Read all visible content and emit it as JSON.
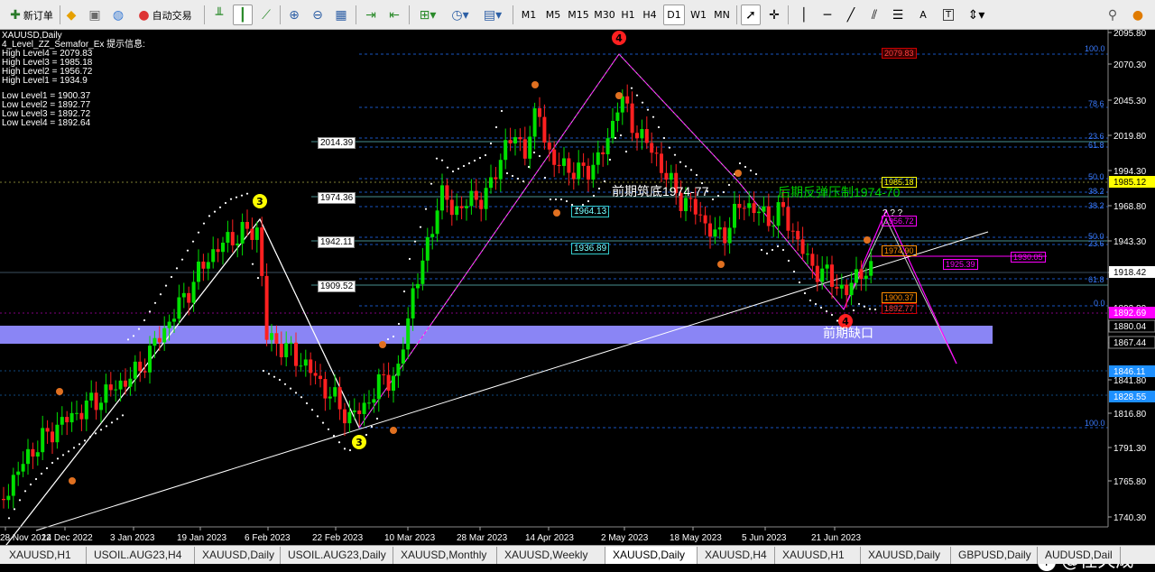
{
  "toolbar": {
    "new_order": "新订单",
    "auto_trading": "自动交易",
    "timeframes": [
      "M1",
      "M5",
      "M15",
      "M30",
      "H1",
      "H4",
      "D1",
      "W1",
      "MN"
    ],
    "active_timeframe": "D1",
    "text_tool": "A",
    "label_tool": "T"
  },
  "info_panel": {
    "symbol": "XAUUSD,Daily",
    "indicator": "4_Level_ZZ_Semafor_Ex 提示信息:",
    "high_levels": [
      "High Level4 = 2079.83",
      "High Level3 = 1985.18",
      "High Level2 = 1956.72",
      "High Level1 = 1934.9"
    ],
    "low_levels": [
      "Low Level1 = 1900.37",
      "Low Level2 = 1892.77",
      "Low Level3 = 1892.72",
      "Low Level4 = 1892.64"
    ]
  },
  "price_axis": {
    "ticks": [
      "2095.80",
      "2070.30",
      "2045.30",
      "2019.80",
      "1994.30",
      "1968.80",
      "1943.30",
      "1918.42",
      "1892.80",
      "1867.44",
      "1841.80",
      "1816.80",
      "1791.30",
      "1765.80",
      "1740.30"
    ],
    "highlight_labels": [
      {
        "text": "1985.12",
        "bg": "#ffff00",
        "fg": "#000000"
      },
      {
        "text": "1918.42",
        "bg": "#ffffff",
        "fg": "#000000"
      },
      {
        "text": "1892.69",
        "bg": "#ff00ff",
        "fg": "#ffffff"
      },
      {
        "text": "1880.04",
        "bg": "#000000",
        "fg": "#ffffff"
      },
      {
        "text": "1867.44",
        "bg": "#000000",
        "fg": "#ffffff"
      },
      {
        "text": "1846.11",
        "bg": "#1e90ff",
        "fg": "#ffffff"
      },
      {
        "text": "1828.55",
        "bg": "#1e90ff",
        "fg": "#ffffff"
      }
    ]
  },
  "time_axis": [
    "28 Nov 2022",
    "14 Dec 2022",
    "3 Jan 2023",
    "19 Jan 2023",
    "6 Feb 2023",
    "22 Feb 2023",
    "10 Mar 2023",
    "28 Mar 2023",
    "14 Apr 2023",
    "2 May 2023",
    "18 May 2023",
    "5 Jun 2023",
    "21 Jun 2023"
  ],
  "chart_labels": {
    "level_boxes": [
      "2014.39",
      "1974.36",
      "1942.11",
      "1909.52"
    ],
    "cyan_boxes": [
      "1964.13",
      "1936.89"
    ],
    "fib_left": [
      "100.0",
      "78.6",
      "61.8",
      "50.0",
      "38.2",
      "23.6",
      "61.8",
      "0.0",
      "100.0"
    ],
    "fib_right": [
      "23.6",
      "50.0",
      "38.2",
      "38.2",
      "50.0",
      "23.6",
      "61.8",
      "0.0"
    ],
    "red_boxes": [
      "2079.83",
      "1900.37",
      "1892.77"
    ],
    "yellow_box": "1985.18",
    "orange_box": "1974.90",
    "magenta_box": "1956.72",
    "blue_boxes": [
      "1925.39",
      "1930.05"
    ],
    "question": "? ? ?",
    "annotation_support": "前期筑底1974-77",
    "annotation_resistance": "后期反弹压制1974-70",
    "annotation_gap": "前期缺口",
    "semafor": [
      "4",
      "3",
      "3",
      "4"
    ]
  },
  "tabs": [
    "XAUUSD,H1",
    "USOIL.AUG23,H4",
    "XAUUSD,Daily",
    "USOIL.AUG23,Daily",
    "XAUUSD,Monthly",
    "XAUUSD,Weekly",
    "XAUUSD,Daily",
    "XAUUSD,H4",
    "XAUUSD,H1",
    "XAUUSD,Daily",
    "GBPUSD,Daily",
    "AUDUSD,Dail"
  ],
  "active_tab_index": 6,
  "watermark": "@任天成",
  "colors": {
    "bull": "#00e000",
    "bear": "#ff2020",
    "fib": "#1f6fff",
    "gap": "#8a85f5",
    "magenta": "#ff00ff"
  }
}
